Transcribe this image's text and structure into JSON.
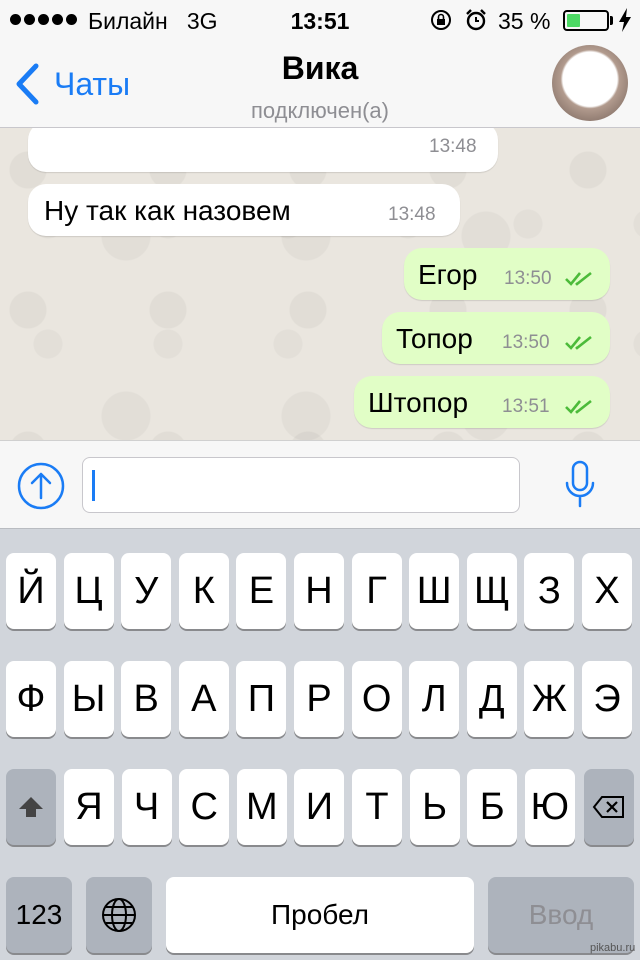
{
  "status_bar": {
    "carrier": "Билайн",
    "network": "3G",
    "time": "13:51",
    "battery_percent": "35 %",
    "battery_level": 0.35,
    "signal_bars": 5,
    "icons": [
      "orientation-lock-icon",
      "alarm-icon",
      "battery-icon",
      "charging-bolt-icon"
    ]
  },
  "nav": {
    "back_label": "Чаты",
    "title": "Вика",
    "subtitle": "подключен(а)"
  },
  "messages": [
    {
      "direction": "in",
      "text": "",
      "time": "13:48"
    },
    {
      "direction": "in",
      "text": "Ну так как назовем",
      "time": "13:48"
    },
    {
      "direction": "out",
      "text": "Егор",
      "time": "13:50",
      "status": "read"
    },
    {
      "direction": "out",
      "text": "Топор",
      "time": "13:50",
      "status": "read"
    },
    {
      "direction": "out",
      "text": "Штопор",
      "time": "13:51",
      "status": "read"
    }
  ],
  "input": {
    "value": "",
    "placeholder": ""
  },
  "keyboard": {
    "row1": [
      "Й",
      "Ц",
      "У",
      "К",
      "Е",
      "Н",
      "Г",
      "Ш",
      "Щ",
      "З",
      "Х"
    ],
    "row2": [
      "Ф",
      "Ы",
      "В",
      "А",
      "П",
      "Р",
      "О",
      "Л",
      "Д",
      "Ж",
      "Э"
    ],
    "row3": [
      "Я",
      "Ч",
      "С",
      "М",
      "И",
      "Т",
      "Ь",
      "Б",
      "Ю"
    ],
    "numbers_label": "123",
    "space_label": "Пробел",
    "return_label": "Ввод"
  },
  "watermark": "pikabu.ru",
  "colors": {
    "accent": "#1a7cf5",
    "outgoing_bubble": "#e1fec6",
    "read_ticks": "#4cbb3a",
    "battery_fill": "#4cd964"
  }
}
